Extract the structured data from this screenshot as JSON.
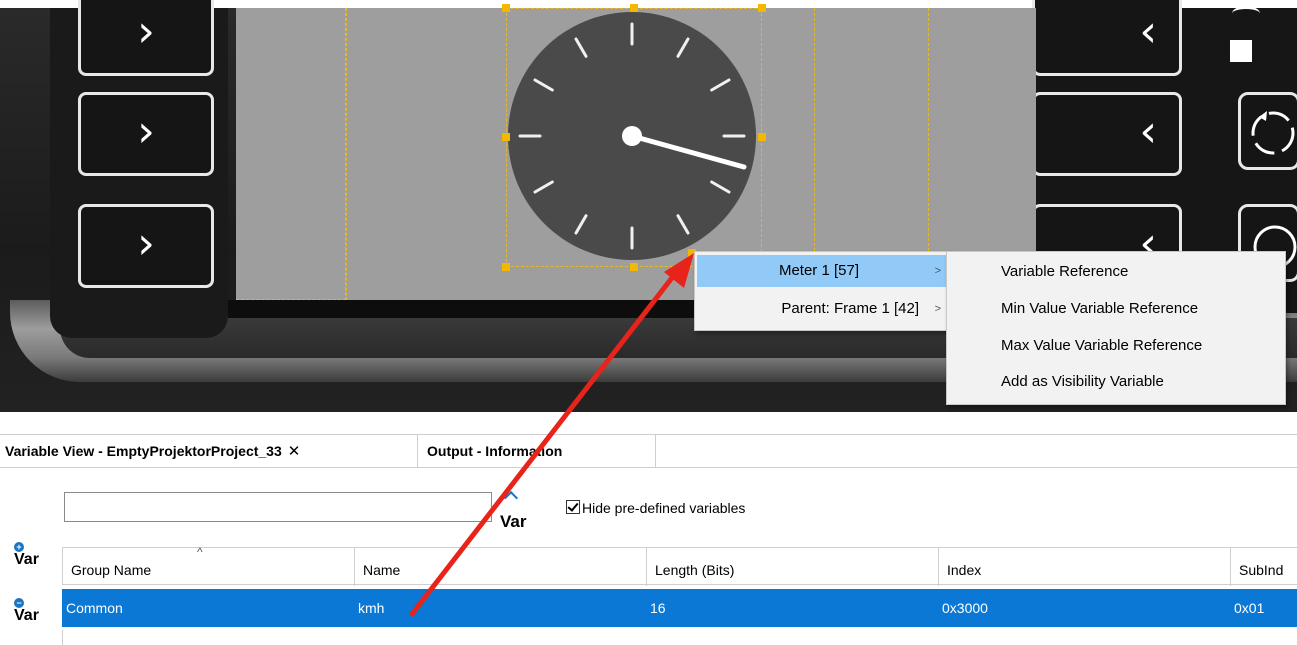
{
  "context_menu": {
    "items": [
      {
        "label": "Meter 1 [57]",
        "highlighted": true
      },
      {
        "label": "Parent: Frame 1 [42]",
        "highlighted": false
      }
    ],
    "submenu": [
      "Variable Reference",
      "Min Value Variable Reference",
      "Max Value Variable Reference",
      "Add as Visibility Variable"
    ]
  },
  "tabs": {
    "variable_view": "Variable View - EmptyProjektorProject_33",
    "close_glyph": "✕",
    "output": "Output - Information"
  },
  "filter": {
    "search_value": "",
    "var_button_label": "Var",
    "hide_predefined_label": "Hide pre-defined variables",
    "hide_predefined_checked": true
  },
  "side_buttons": {
    "add_label": "Var",
    "remove_label": "Var"
  },
  "grid": {
    "columns": [
      "Group Name",
      "Name",
      "Length (Bits)",
      "Index",
      "SubInd"
    ],
    "rows": [
      {
        "group": "Common",
        "name": "kmh",
        "length": "16",
        "index": "0x3000",
        "subindex": "0x01",
        "selected": true
      }
    ]
  },
  "colors": {
    "selection": "#0a78d4",
    "menu_highlight": "#91c9f7",
    "handle": "#f5b800",
    "annotation_arrow": "#e8231a"
  },
  "icons": [
    "chevron-right-icon",
    "chevron-left-icon",
    "rotate-icon",
    "square-icon",
    "var-add-icon",
    "var-remove-icon"
  ]
}
